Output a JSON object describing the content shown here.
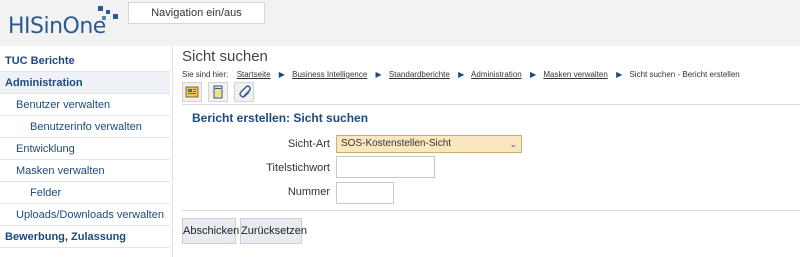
{
  "header": {
    "logo_text": "HISinOne",
    "nav_toggle_label": "Navigation ein/aus",
    "brand_color": "#2b5a93"
  },
  "sidebar": {
    "items": [
      {
        "label": "TUC Berichte",
        "level": 0
      },
      {
        "label": "Administration",
        "level": 0
      },
      {
        "label": "Benutzer verwalten",
        "level": 1
      },
      {
        "label": "Benutzerinfo verwalten",
        "level": 2
      },
      {
        "label": "Entwicklung",
        "level": 1
      },
      {
        "label": "Masken verwalten",
        "level": 1
      },
      {
        "label": "Felder",
        "level": 2
      },
      {
        "label": "Uploads/Downloads verwalten",
        "level": 1
      },
      {
        "label": "Bewerbung, Zulassung",
        "level": 0
      }
    ]
  },
  "main": {
    "page_title": "Sicht suchen",
    "breadcrumb": {
      "prefix": "Sie sind hier:",
      "links": [
        "Startseite",
        "Business Intelligence",
        "Standardberichte",
        "Administration",
        "Masken verwalten"
      ],
      "current": "Sicht suchen - Bericht erstellen"
    },
    "toolbar_icons": [
      "report-icon",
      "bookmark-icon",
      "attachment-icon"
    ],
    "panel": {
      "title": "Bericht erstellen: Sicht suchen",
      "fields": {
        "sicht_art_label": "Sicht-Art",
        "sicht_art_value": "SOS-Kostenstellen-Sicht",
        "titelstichwort_label": "Titelstichwort",
        "titelstichwort_value": "",
        "nummer_label": "Nummer",
        "nummer_value": ""
      }
    },
    "buttons": {
      "submit_label": "Abschicken",
      "reset_label": "Zurücksetzen"
    }
  }
}
